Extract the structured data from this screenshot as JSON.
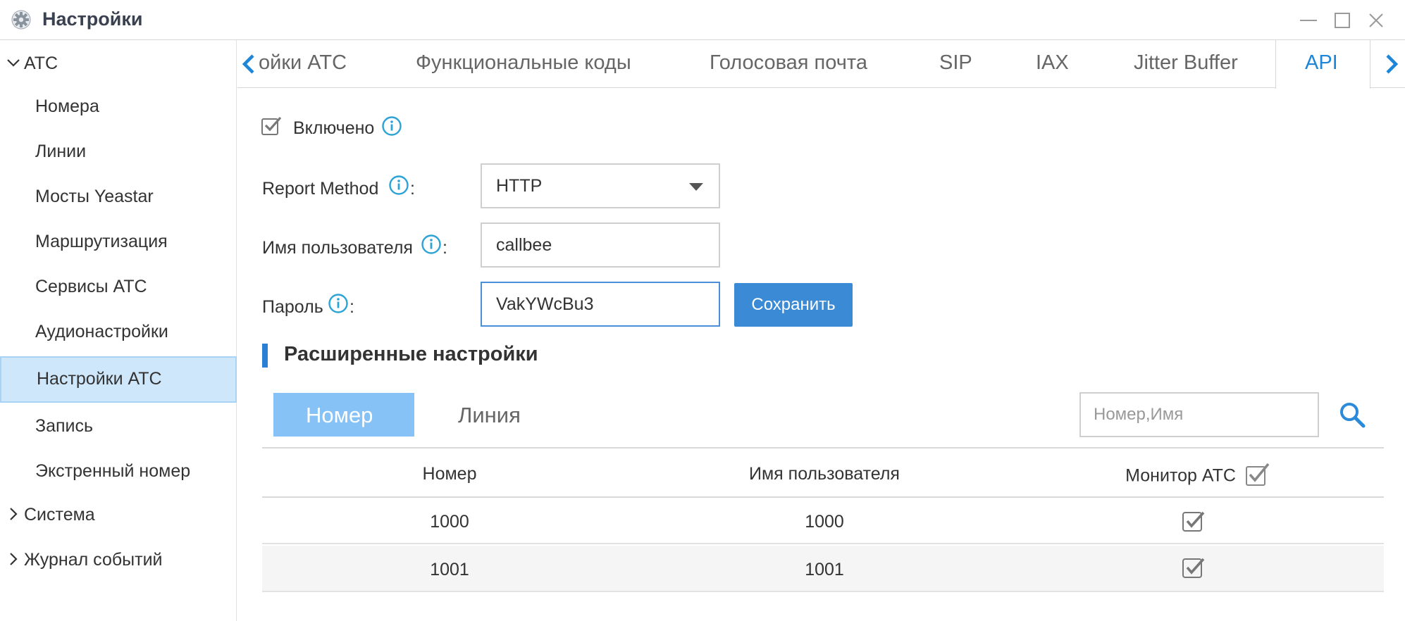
{
  "window": {
    "title": "Настройки",
    "icons": {
      "app": "gear-icon",
      "minimize": "minimize-icon",
      "maximize": "maximize-icon",
      "close": "close-icon"
    }
  },
  "sidebar": {
    "groups": {
      "ats": "АТС",
      "system": "Система",
      "events": "Журнал событий"
    },
    "items": [
      {
        "label": "Номера"
      },
      {
        "label": "Линии"
      },
      {
        "label": "Мосты Yeastar"
      },
      {
        "label": "Маршрутизация"
      },
      {
        "label": "Сервисы АТС"
      },
      {
        "label": "Аудионастройки"
      },
      {
        "label": "Настройки АТС",
        "active": true
      },
      {
        "label": "Запись"
      },
      {
        "label": "Экстренный номер"
      }
    ]
  },
  "tabs": {
    "items": [
      {
        "label": "ойки АТС"
      },
      {
        "label": "Функциональные коды"
      },
      {
        "label": "Голосовая почта"
      },
      {
        "label": "SIP"
      },
      {
        "label": "IAX"
      },
      {
        "label": "Jitter Buffer"
      },
      {
        "label": "API",
        "active": true
      }
    ]
  },
  "form": {
    "enabled_label": "Включено",
    "enabled_checked": true,
    "report_method_label": "Report Method",
    "report_method_value": "HTTP",
    "username_label": "Имя пользователя",
    "username_value": "callbee",
    "password_label": "Пароль",
    "password_value": "VakYWcBu3",
    "colon": ":",
    "save_label": "Сохранить"
  },
  "advanced": {
    "title": "Расширенные настройки",
    "subtabs": {
      "number": "Номер",
      "line": "Линия"
    },
    "search_placeholder": "Номер,Имя"
  },
  "table": {
    "headers": {
      "number": "Номер",
      "username": "Имя пользователя",
      "monitor": "Монитор АТС"
    },
    "rows": [
      {
        "number": "1000",
        "username": "1000",
        "monitor": true
      },
      {
        "number": "1001",
        "username": "1001",
        "monitor": true
      }
    ]
  },
  "colors": {
    "accent": "#1e86d7",
    "button": "#3a8ad6",
    "active_subtab": "#86c2f6",
    "sidebar_active": "#cfe7fb",
    "info": "#2ba3d6"
  }
}
